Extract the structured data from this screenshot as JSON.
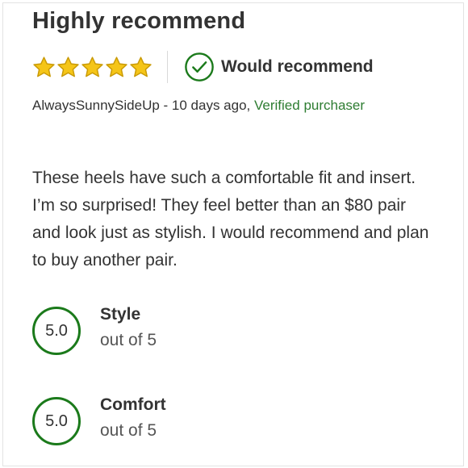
{
  "review": {
    "title": "Highly recommend",
    "rating": 5,
    "rating_max": 5,
    "recommend_label": "Would recommend",
    "author": "AlwaysSunnySideUp",
    "separator": " - ",
    "date": "10 days ago,",
    "verified_label": "Verified purchaser",
    "body": "These heels have such a comfortable fit and insert. I’m so surprised! They feel better than an $80 pair and look just as stylish. I would recommend and plan to buy another pair."
  },
  "attributes": [
    {
      "score": "5.0",
      "name": "Style",
      "scale": "out of 5"
    },
    {
      "score": "5.0",
      "name": "Comfort",
      "scale": "out of 5"
    }
  ],
  "colors": {
    "star": "#f5c518",
    "star_stroke": "#c99a06",
    "accent_green": "#1b7a1b",
    "verified_green": "#2e7d32",
    "text": "#333333"
  },
  "icons": {
    "star": "star-icon",
    "recommend": "check-circle-icon"
  }
}
